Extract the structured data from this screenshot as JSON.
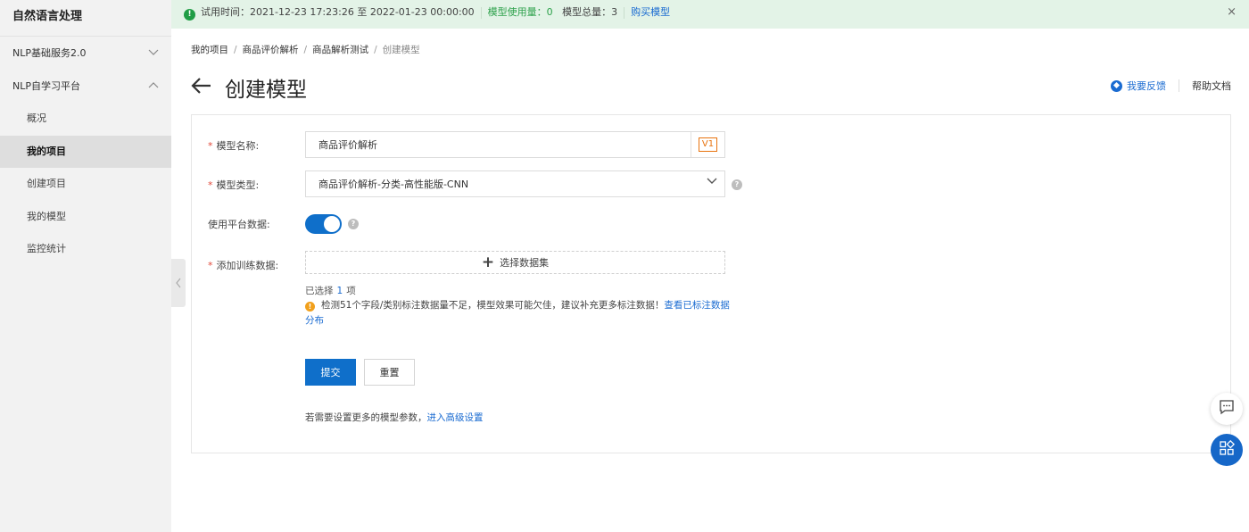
{
  "sidebar": {
    "title": "自然语言处理",
    "groups": [
      {
        "label": "NLP基础服务2.0",
        "state": "collapsed"
      },
      {
        "label": "NLP自学习平台",
        "state": "expanded"
      }
    ],
    "items": [
      {
        "label": "概况"
      },
      {
        "label": "我的项目",
        "active": true
      },
      {
        "label": "创建项目"
      },
      {
        "label": "我的模型"
      },
      {
        "label": "监控统计"
      }
    ]
  },
  "trial_bar": {
    "label": "试用时间：2021-12-23 17:23:26 至 2022-01-23 00:00:00",
    "usage": "模型使用量：0",
    "total": "模型总量：3",
    "buy_link": "购买模型",
    "close": "×"
  },
  "breadcrumb": [
    "我的项目",
    "商品评价解析",
    "商品解析测试",
    "创建模型"
  ],
  "page": {
    "title": "创建模型",
    "feedback": "我要反馈",
    "help": "帮助文档"
  },
  "form": {
    "name_label": "模型名称:",
    "name_value": "商品评价解析",
    "version": "V1",
    "type_label": "模型类型:",
    "type_value": "商品评价解析-分类-高性能版-CNN",
    "platform_label": "使用平台数据:",
    "platform_enabled": true,
    "dataset_label": "添加训练数据:",
    "dataset_button": "选择数据集",
    "selected_prefix": "已选择",
    "selected_count": "1",
    "selected_suffix": "项",
    "warning_text": "检测51个字段/类别标注数据量不足，模型效果可能欠佳，建议补充更多标注数据！",
    "warning_link": "查看已标注数据分布",
    "submit": "提交",
    "reset": "重置",
    "advanced_text": "若需要设置更多的模型参数，",
    "advanced_link": "进入高级设置"
  },
  "colors": {
    "primary": "#0f6fca",
    "link": "#1a6bd1",
    "success_bg": "#e3f3e7",
    "warning": "#f1a01c",
    "version_tag": "#e8730e"
  }
}
